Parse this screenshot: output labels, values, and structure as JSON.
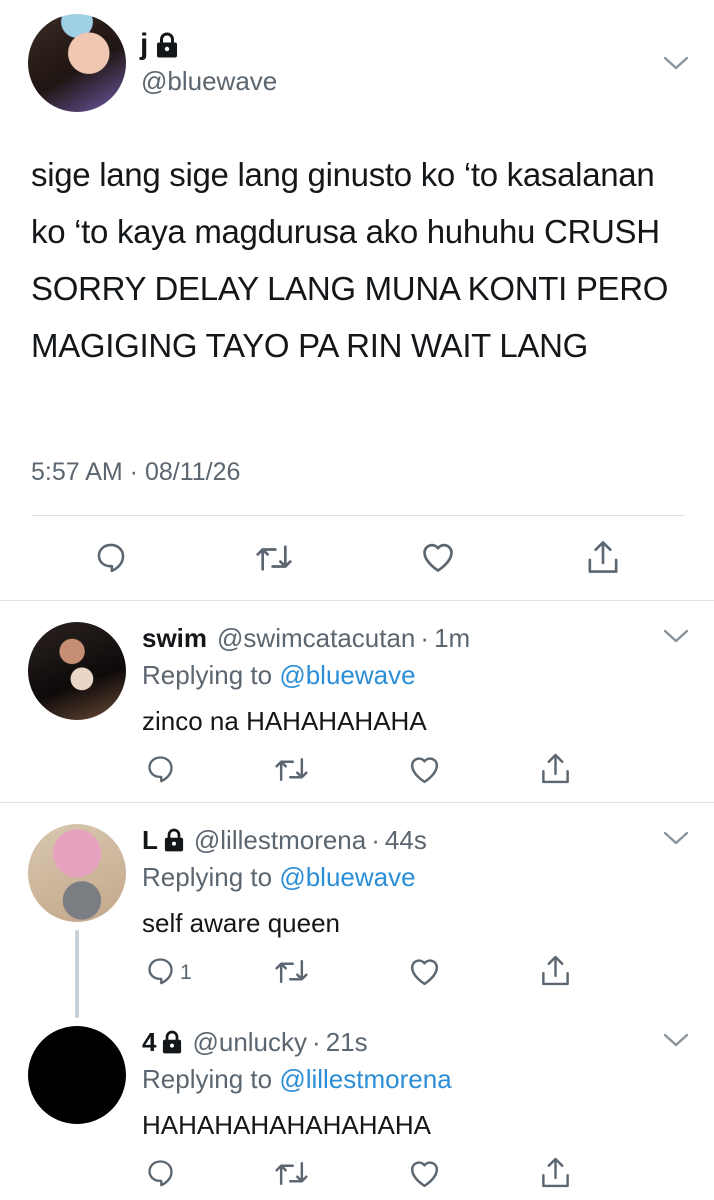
{
  "main": {
    "name": "j",
    "handle": "@bluewave",
    "text": "sige lang sige lang ginusto ko ‘to kasalanan ko ‘to kaya magdurusa ako huhuhu CRUSH SORRY DELAY LANG MUNA KONTI PERO MAGIGING TAYO PA RIN WAIT LANG",
    "time": "5:57 AM · 08/11/26",
    "protected": true
  },
  "replies": [
    {
      "name": "swim",
      "handle": "@swimcatacutan",
      "time": "1m",
      "replying_label": "Replying to",
      "replying_to": "@bluewave",
      "text": "zinco na HAHAHAHAHA",
      "reply_count": "",
      "protected": false
    },
    {
      "name": "L",
      "handle": "@lillestmorena",
      "time": "44s",
      "replying_label": "Replying to",
      "replying_to": "@bluewave",
      "text": "self aware queen",
      "reply_count": "1",
      "protected": true
    },
    {
      "name": "4",
      "handle": "@unlucky",
      "time": "21s",
      "replying_label": "Replying to",
      "replying_to": "@lillestmorena",
      "text": "HAHAHAHAHAHAHAHA",
      "reply_count": "",
      "protected": true
    }
  ],
  "icons": {
    "reply": "reply-icon",
    "retweet": "retweet-icon",
    "like": "heart-icon",
    "share": "share-icon",
    "lock": "lock-icon",
    "more": "chevron-down-icon"
  },
  "colors": {
    "text": "#14171a",
    "secondary": "#5b6670",
    "mention": "#2b8ed6",
    "divider": "#dfe3e7"
  }
}
